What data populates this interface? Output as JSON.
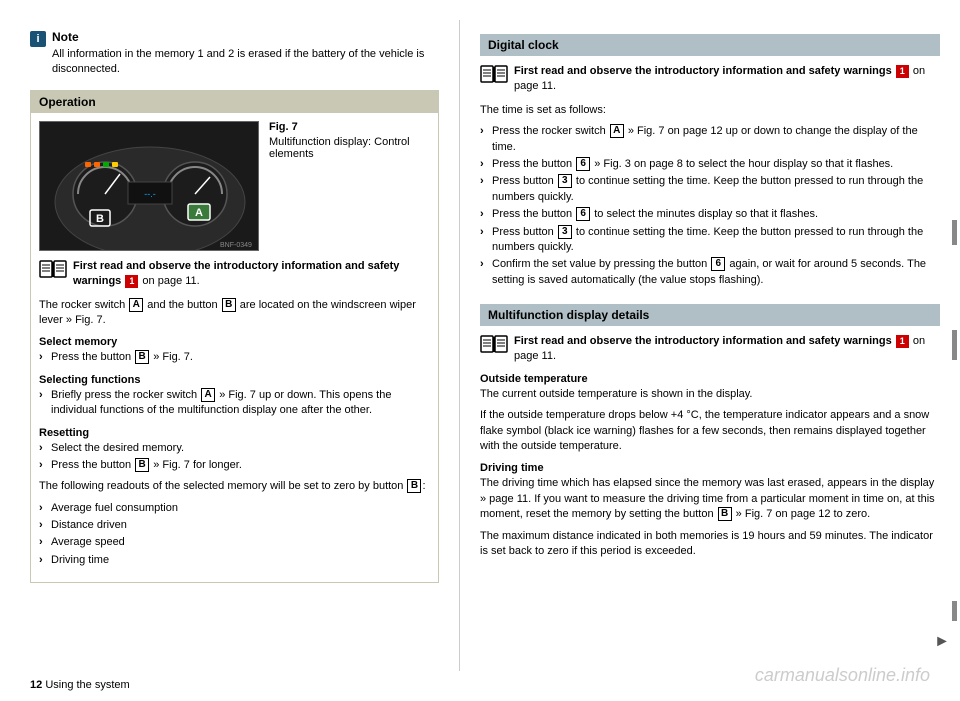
{
  "page": {
    "number": "12",
    "footer_text": "Using the system"
  },
  "left_column": {
    "note": {
      "icon": "i",
      "title": "Note",
      "text": "All information in the memory 1 and 2 is erased if the battery of the vehicle is disconnected."
    },
    "operation_section": {
      "header": "Operation",
      "figure": {
        "number": "Fig. 7",
        "caption": "Multifunction display: Control elements",
        "label_b": "B",
        "label_a": "A",
        "image_ref": "BNF-0349"
      },
      "warn_text": "First read and observe the introductory information and safety warnings",
      "warn_page_ref": "1",
      "warn_page_num": "on page 11.",
      "rocker_text_1": "The rocker switch",
      "rocker_box_a": "A",
      "rocker_text_2": "and the button",
      "rocker_box_b": "B",
      "rocker_text_3": "are located on the windscreen wiper lever » Fig. 7.",
      "select_memory": {
        "heading": "Select memory",
        "bullet": "Press the button B » Fig. 7."
      },
      "selecting_functions": {
        "heading": "Selecting functions",
        "bullet": "Briefly press the rocker switch A » Fig. 7 up or down. This opens the individual functions of the multifunction display one after the other."
      },
      "resetting": {
        "heading": "Resetting",
        "bullets": [
          "Select the desired memory.",
          "Press the button B » Fig. 7 for longer."
        ]
      },
      "following_text": "The following readouts of the selected memory will be set to zero by button B:",
      "readouts": [
        "Average fuel consumption",
        "Distance driven",
        "Average speed",
        "Driving time"
      ]
    }
  },
  "right_column": {
    "digital_clock": {
      "header": "Digital clock",
      "warn_text": "First read and observe the introductory information and safety warnings",
      "warn_page_ref": "1",
      "warn_page_num": "on page 11.",
      "time_set_intro": "The time is set as follows:",
      "steps": [
        "Press the rocker switch A » Fig. 7 on page 12 up or down to change the display of the time.",
        "Press the button 6 » Fig. 3 on page 8 to select the hour display so that it flashes.",
        "Press button 3 to continue setting the time. Keep the button pressed to run through the numbers quickly.",
        "Press the button 6 to select the minutes display so that it flashes.",
        "Press button 3 to continue setting the time. Keep the button pressed to run through the numbers quickly.",
        "Confirm the set value by pressing the button 6 again, or wait for around 5 seconds. The setting is saved automatically (the value stops flashing)."
      ]
    },
    "multifunction_display": {
      "header": "Multifunction display details",
      "warn_text": "First read and observe the introductory information and safety warnings",
      "warn_page_ref": "1",
      "warn_page_num": "on page 11.",
      "outside_temp": {
        "heading": "Outside temperature",
        "text": "The current outside temperature is shown in the display."
      },
      "outside_temp_note": "If the outside temperature drops below +4 °C, the temperature indicator appears and a snow flake symbol (black ice warning) flashes for a few seconds, then remains displayed together with the outside temperature.",
      "driving_time": {
        "heading": "Driving time",
        "text": "The driving time which has elapsed since the memory was last erased, appears in the display » page 11. If you want to measure the driving time from a particular moment in time on, at this moment, reset the memory by setting the button B » Fig. 7 on page 12 to zero."
      },
      "max_distance_text": "The maximum distance indicated in both memories is 19 hours and 59 minutes. The indicator is set back to zero if this period is exceeded."
    }
  },
  "icons": {
    "info_icon": "i",
    "book_icon": "book",
    "chevron_right": "›"
  }
}
